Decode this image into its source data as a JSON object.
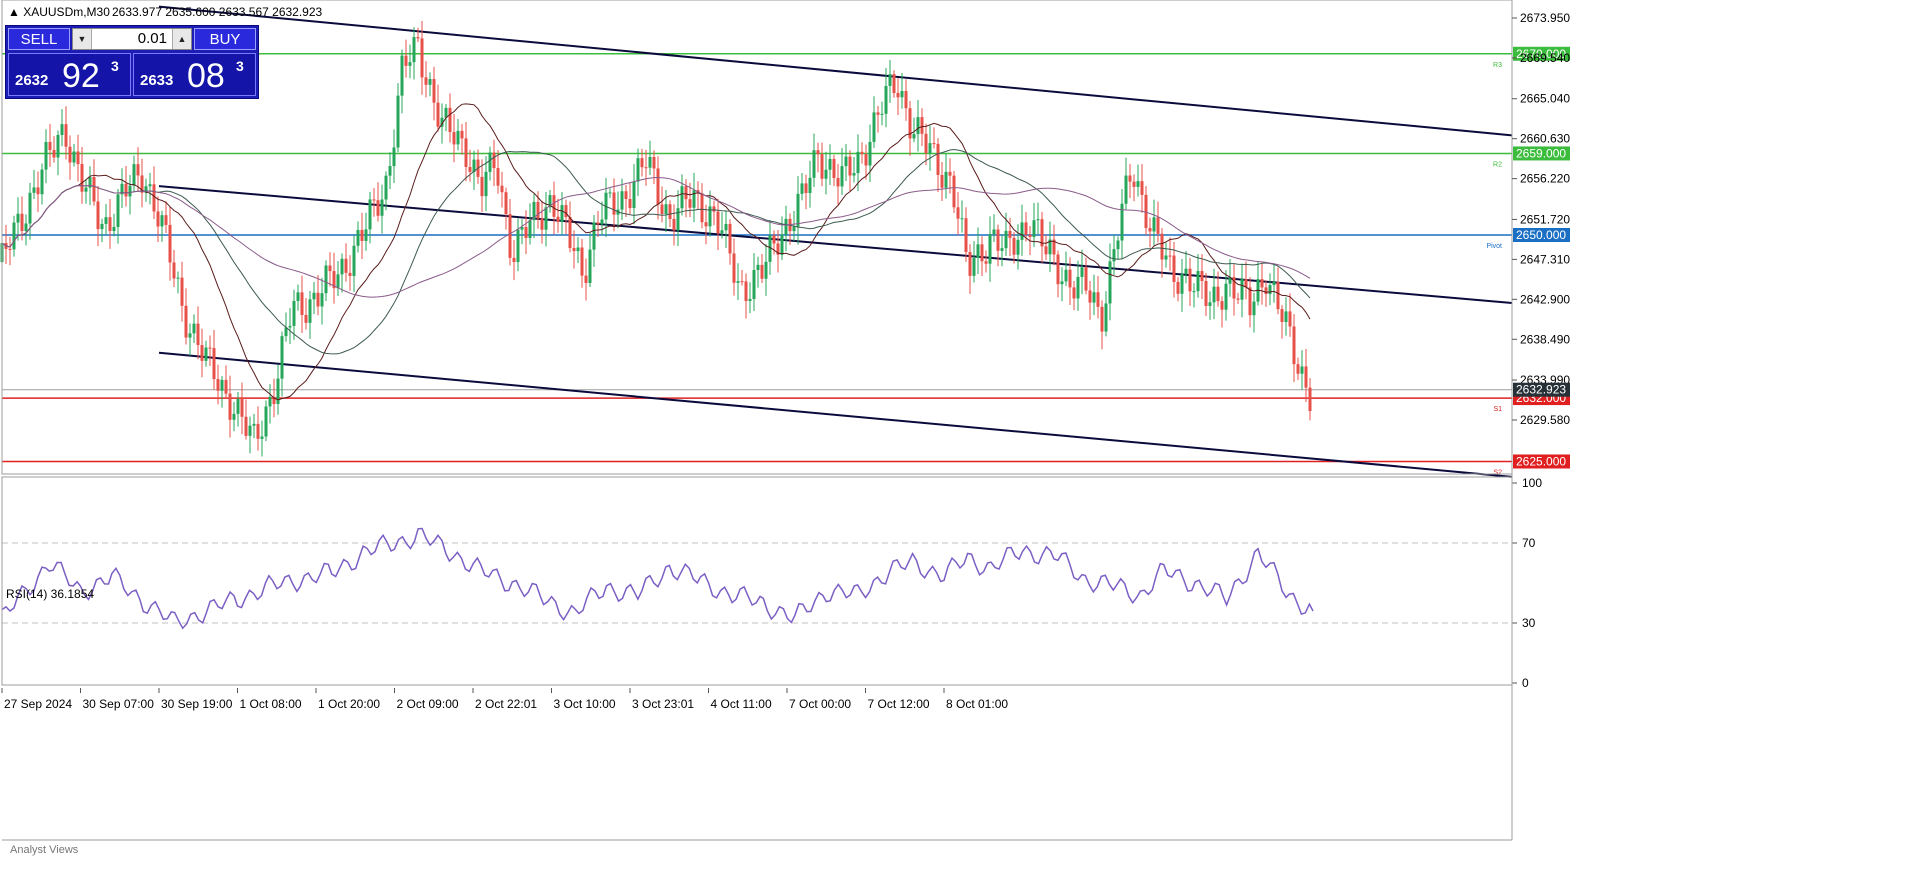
{
  "symbol_line": {
    "title": "XAUUSDm,M30",
    "ohlc": "2633.977 2635.600 2633.567 2632.923"
  },
  "trade_panel": {
    "sell_label": "SELL",
    "buy_label": "BUY",
    "lot": "0.01",
    "bid": {
      "prefix": "2632",
      "big": "92",
      "sup": "3"
    },
    "ask": {
      "prefix": "2633",
      "big": "08",
      "sup": "3"
    }
  },
  "indicator_label": "RSI(14) 36.1854",
  "bottom_label": "Analyst Views",
  "colors": {
    "bull": "#26a65b",
    "bear": "#e8504a",
    "support": "#e02020",
    "resistance": "#3cbc3c",
    "pivot": "#1a6fc4",
    "rsi": "#7b5fc4",
    "trend": "#0a0a3c",
    "current": "#263238"
  },
  "chart_data": [
    {
      "type": "candlestick",
      "title": "",
      "y_ticks": [
        2673.95,
        2669.54,
        2665.04,
        2660.63,
        2656.22,
        2651.72,
        2647.31,
        2642.9,
        2638.49,
        2633.99,
        2629.58
      ],
      "x_ticks": [
        "27 Sep 2024",
        "30 Sep 07:00",
        "30 Sep 19:00",
        "1 Oct 08:00",
        "1 Oct 20:00",
        "2 Oct 09:00",
        "2 Oct 22:01",
        "3 Oct 10:00",
        "3 Oct 23:01",
        "4 Oct 11:00",
        "7 Oct 00:00",
        "7 Oct 12:00",
        "8 Oct 01:00"
      ],
      "current_price": 2632.923,
      "levels": [
        {
          "name": "R3",
          "price": 2670.0,
          "kind": "resistance"
        },
        {
          "name": "R2",
          "price": 2659.0,
          "kind": "resistance"
        },
        {
          "name": "Pivot",
          "price": 2650.0,
          "kind": "pivot"
        },
        {
          "name": "S1",
          "price": 2632.0,
          "kind": "support"
        },
        {
          "name": "S2",
          "price": 2625.0,
          "kind": "support"
        }
      ],
      "trendlines": [
        {
          "from": [
            "30 Sep 19:00",
            2675.2
          ],
          "to": [
            "end",
            2661.0
          ]
        },
        {
          "from": [
            "30 Sep 19:00",
            2655.4
          ],
          "to": [
            "end",
            2642.5
          ]
        },
        {
          "from": [
            "30 Sep 19:00",
            2637.0
          ],
          "to": [
            "end",
            2623.3
          ]
        }
      ],
      "close_path": [
        [
          "27 Sep 2024",
          2647.0
        ],
        [
          0.4,
          2655.0
        ],
        [
          0.8,
          2662.0
        ],
        [
          1.0,
          2656.0
        ],
        [
          1.3,
          2651.0
        ],
        [
          1.6,
          2655.0
        ],
        [
          1.8,
          2657.0
        ],
        [
          2.0,
          2652.0
        ],
        [
          2.3,
          2642.0
        ],
        [
          2.6,
          2636.0
        ],
        [
          2.9,
          2632.0
        ],
        [
          3.2,
          2627.0
        ],
        [
          3.5,
          2634.0
        ],
        [
          3.7,
          2642.0
        ],
        [
          4.0,
          2643.0
        ],
        [
          4.3,
          2646.0
        ],
        [
          4.6,
          2650.0
        ],
        [
          4.9,
          2656.0
        ],
        [
          5.1,
          2668.0
        ],
        [
          5.3,
          2671.0
        ],
        [
          5.6,
          2662.0
        ],
        [
          5.9,
          2660.0
        ],
        [
          6.1,
          2655.0
        ],
        [
          6.3,
          2658.0
        ],
        [
          6.5,
          2648.0
        ],
        [
          6.8,
          2652.0
        ],
        [
          7.0,
          2654.0
        ],
        [
          7.2,
          2650.0
        ],
        [
          7.4,
          2646.0
        ],
        [
          7.6,
          2652.0
        ],
        [
          7.9,
          2654.0
        ],
        [
          8.2,
          2658.0
        ],
        [
          8.5,
          2652.0
        ],
        [
          8.8,
          2654.0
        ],
        [
          9.1,
          2652.0
        ],
        [
          9.4,
          2644.0
        ],
        [
          9.7,
          2646.0
        ],
        [
          9.9,
          2650.0
        ],
        [
          10.2,
          2654.0
        ],
        [
          10.4,
          2659.0
        ],
        [
          10.7,
          2656.0
        ],
        [
          10.9,
          2658.0
        ],
        [
          11.2,
          2664.0
        ],
        [
          11.4,
          2667.0
        ],
        [
          11.6,
          2662.0
        ],
        [
          11.9,
          2658.0
        ],
        [
          12.1,
          2656.0
        ],
        [
          12.3,
          2646.0
        ],
        [
          12.6,
          2650.0
        ],
        [
          12.8,
          2648.0
        ],
        [
          13.1,
          2652.0
        ],
        [
          13.3,
          2648.0
        ],
        [
          13.6,
          2645.0
        ],
        [
          13.8,
          2644.0
        ],
        [
          14.0,
          2641.0
        ],
        [
          14.2,
          2650.0
        ],
        [
          14.4,
          2657.0
        ],
        [
          14.7,
          2650.0
        ],
        [
          14.9,
          2645.0
        ],
        [
          15.1,
          2646.0
        ],
        [
          15.4,
          2642.0
        ],
        [
          15.6,
          2645.0
        ],
        [
          15.9,
          2642.0
        ],
        [
          16.1,
          2646.0
        ],
        [
          16.3,
          2641.0
        ],
        [
          16.5,
          2636.0
        ],
        [
          16.7,
          2632.0
        ]
      ]
    },
    {
      "type": "line",
      "title": "RSI(14) 36.1854",
      "ylim": [
        0,
        100
      ],
      "y_ticks": [
        100,
        70,
        30,
        0
      ],
      "guides": [
        70,
        30
      ],
      "x": [
        0,
        0.6,
        1.0,
        1.4,
        1.8,
        2.2,
        2.6,
        3.0,
        3.4,
        3.8,
        4.2,
        4.6,
        5.0,
        5.3,
        5.7,
        6.1,
        6.5,
        6.9,
        7.3,
        7.7,
        8.1,
        8.5,
        8.9,
        9.3,
        9.7,
        10.1,
        10.5,
        10.9,
        11.3,
        11.6,
        12.0,
        12.3,
        12.6,
        13.0,
        13.4,
        13.8,
        14.2,
        14.5,
        14.8,
        15.2,
        15.6,
        16.0,
        16.4,
        16.7
      ],
      "values": [
        32,
        60,
        46,
        53,
        41,
        30,
        36,
        42,
        48,
        52,
        55,
        65,
        70,
        74,
        66,
        56,
        50,
        42,
        35,
        48,
        44,
        58,
        51,
        44,
        40,
        32,
        46,
        44,
        56,
        60,
        54,
        62,
        58,
        66,
        64,
        52,
        48,
        44,
        56,
        50,
        42,
        65,
        44,
        36
      ]
    }
  ]
}
